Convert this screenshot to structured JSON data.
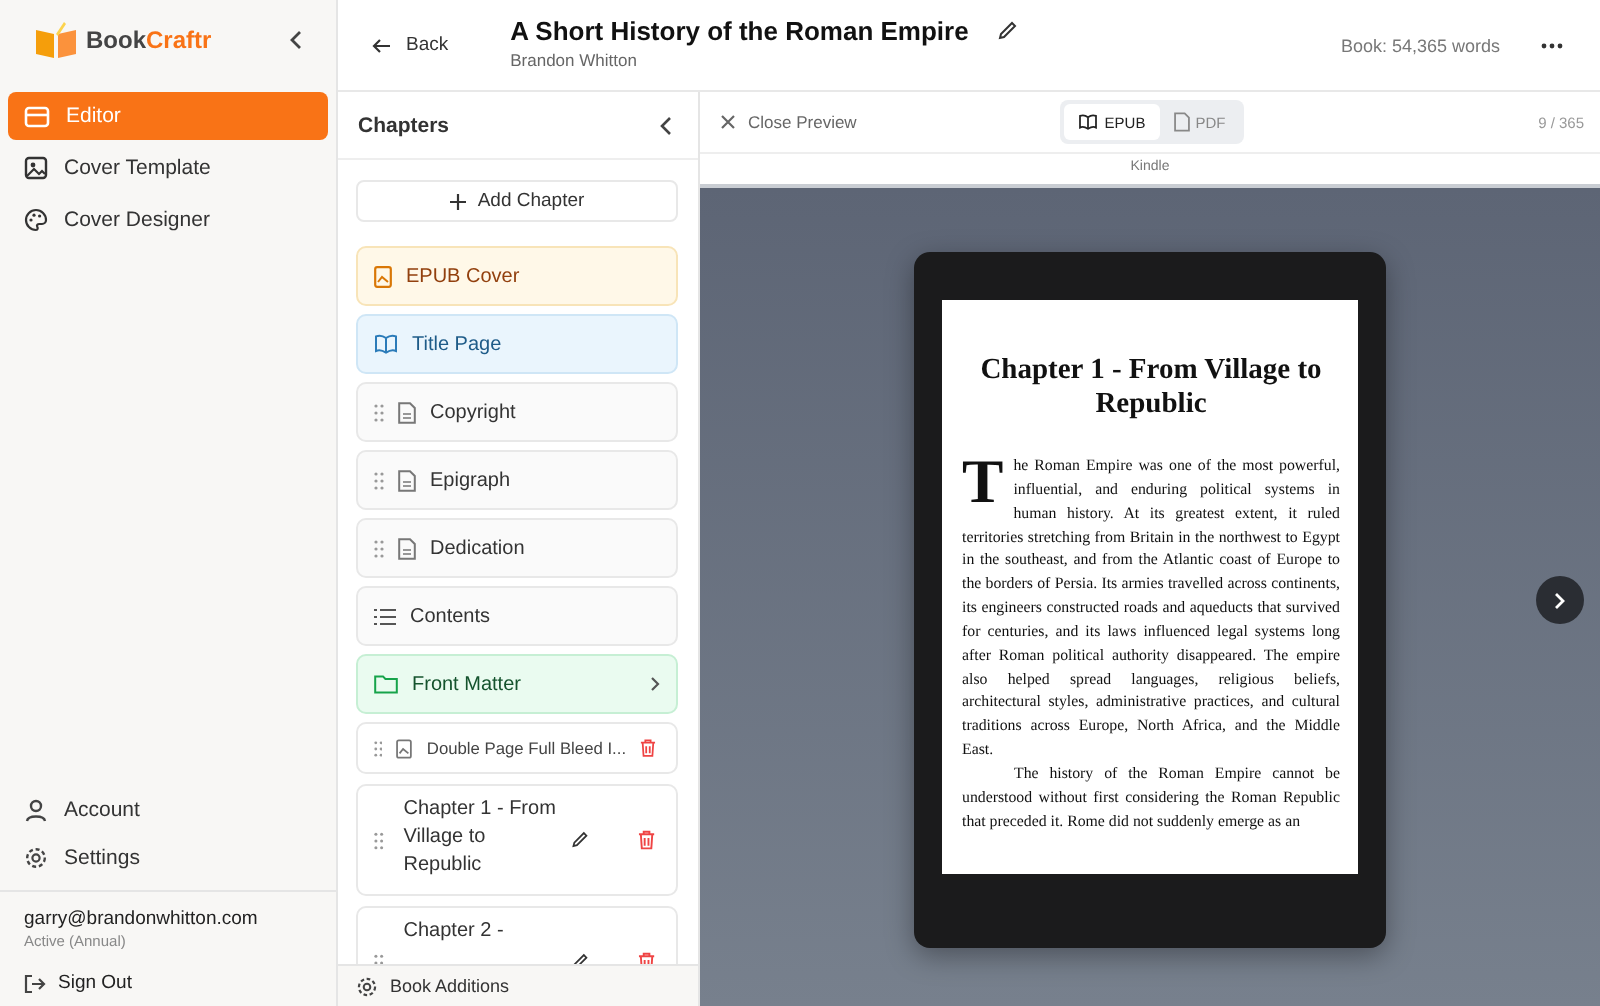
{
  "brand": {
    "name_part_1": "Book",
    "name_part_2": "Craftr"
  },
  "nav": [
    {
      "label": "Editor",
      "selected": true
    },
    {
      "label": "Cover Template",
      "selected": false
    },
    {
      "label": "Cover Designer",
      "selected": false
    }
  ],
  "account_menu": [
    "Account",
    "Settings"
  ],
  "user": {
    "email": "garry@brandonwhitton.com",
    "plan": "Active (Annual)",
    "sign_out": "Sign Out"
  },
  "header": {
    "back": "Back",
    "title": "A Short History of the Roman Empire",
    "author": "Brandon Whitton",
    "word_count": "Book: 54,365 words"
  },
  "chapters": {
    "title": "Chapters",
    "add_button": "Add Chapter",
    "items": [
      {
        "kind": "cover",
        "label": "EPUB Cover"
      },
      {
        "kind": "title",
        "label": "Title Page"
      },
      {
        "kind": "page",
        "label": "Copyright"
      },
      {
        "kind": "page",
        "label": "Epigraph"
      },
      {
        "kind": "page",
        "label": "Dedication"
      },
      {
        "kind": "contents",
        "label": "Contents"
      },
      {
        "kind": "folder",
        "label": "Front Matter"
      },
      {
        "kind": "image",
        "label": "Double Page Full Bleed I..."
      },
      {
        "kind": "chapter",
        "label": "Chapter 1 - From Village to Republic"
      },
      {
        "kind": "chapter",
        "label": "Chapter 2 -"
      }
    ],
    "footer": "Book Additions"
  },
  "preview": {
    "close": "Close Preview",
    "formats": [
      {
        "label": "EPUB",
        "selected": true
      },
      {
        "label": "PDF",
        "selected": false
      }
    ],
    "page_counter": "9 / 365",
    "device": "Kindle",
    "page": {
      "heading": "Chapter 1 - From Village to Republic",
      "paragraphs": [
        "The Roman Empire was one of the most powerful, influential, and enduring political systems in human history. At its greatest extent, it ruled territories stretching from Britain in the northwest to Egypt in the southeast, and from the Atlantic coast of Europe to the borders of Persia. Its armies travelled across continents, its engineers constructed roads and aqueducts that survived for centuries, and its laws influenced legal systems long after Roman political authority disappeared. The empire also helped spread languages, religious beliefs, architectural styles, administrative practices, and cultural traditions across Europe, North Africa, and the Middle East.",
        "The history of the Roman Empire cannot be understood without first considering the Roman Republic that preceded it. Rome did not suddenly emerge as an"
      ]
    }
  }
}
